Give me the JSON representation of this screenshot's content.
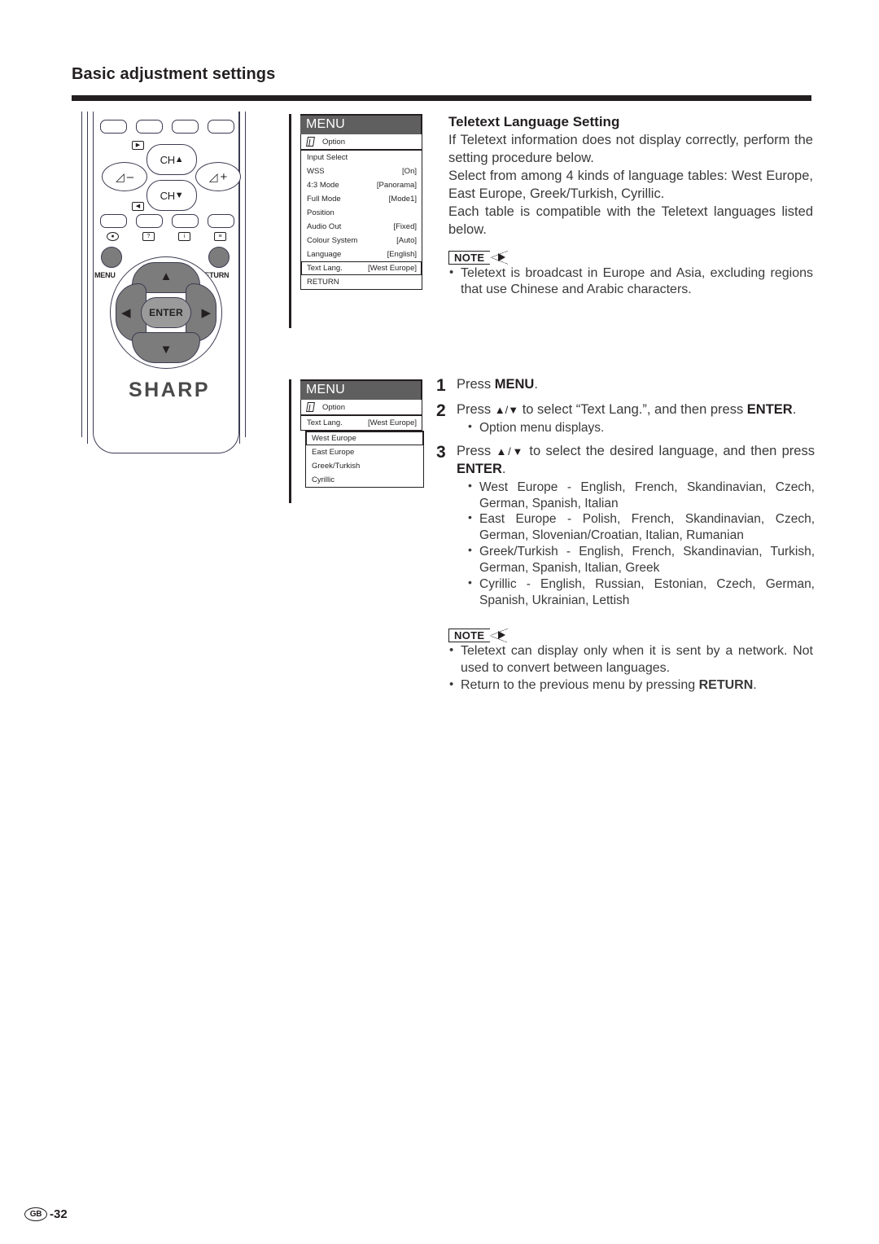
{
  "page": {
    "title": "Basic adjustment settings",
    "footer_region": "GB",
    "footer_page": "-32"
  },
  "remote": {
    "brand": "SHARP",
    "ch_up_label": "CH",
    "ch_down_label": "CH",
    "vol_down_label": "–",
    "vol_up_label": "+",
    "menu_label": "MENU",
    "return_label": "RETURN",
    "enter_label": "ENTER"
  },
  "osd_menu_1": {
    "header": "MENU",
    "option_label": "Option",
    "rows": [
      {
        "label": "Input Select",
        "value": ""
      },
      {
        "label": "WSS",
        "value": "[On]"
      },
      {
        "label": "4:3 Mode",
        "value": "[Panorama]"
      },
      {
        "label": "Full Mode",
        "value": "[Mode1]"
      },
      {
        "label": "Position",
        "value": ""
      },
      {
        "label": "Audio Out",
        "value": "[Fixed]"
      },
      {
        "label": "Colour System",
        "value": "[Auto]"
      },
      {
        "label": "Language",
        "value": "[English]"
      },
      {
        "label": "Text Lang.",
        "value": "[West Europe]"
      },
      {
        "label": "RETURN",
        "value": ""
      }
    ],
    "selected_index": 8
  },
  "osd_menu_2": {
    "header": "MENU",
    "option_label": "Option",
    "parent_row": {
      "label": "Text Lang.",
      "value": "[West Europe]"
    },
    "choices": [
      "West Europe",
      "East Europe",
      "Greek/Turkish",
      "Cyrillic"
    ],
    "selected_index": 0
  },
  "section": {
    "title": "Teletext Language Setting",
    "paragraphs": [
      "If Teletext information does not display correctly, perform the setting procedure below.",
      "Select from among 4 kinds of language tables: West Europe, East Europe, Greek/Turkish, Cyrillic.",
      "Each table is compatible with the Teletext languages listed below."
    ],
    "note_label": "NOTE",
    "note_bullets": [
      "Teletext is broadcast in Europe and Asia, excluding regions that use Chinese and Arabic characters."
    ]
  },
  "steps": [
    {
      "num": "1",
      "text_before": "Press ",
      "bold": "MENU",
      "text_after": ".",
      "sub": []
    },
    {
      "num": "2",
      "text_before": "Press ",
      "arrows": "▲/▼",
      "text_mid": " to select “Text Lang.”, and then press ",
      "bold": "ENTER",
      "text_after": ".",
      "sub": [
        "Option menu displays."
      ]
    },
    {
      "num": "3",
      "text_before": "Press ",
      "arrows": "▲/▼",
      "text_mid": " to select the desired language, and then press ",
      "bold": "ENTER",
      "text_after": ".",
      "sub": [
        "West Europe - English, French, Skandinavian, Czech, German, Spanish, Italian",
        "East Europe - Polish, French, Skandinavian, Czech, German, Slovenian/Croatian, Italian, Rumanian",
        "Greek/Turkish - English, French, Skandinavian, Turkish, German, Spanish, Italian, Greek",
        "Cyrillic - English, Russian, Estonian, Czech, German, Spanish, Ukrainian, Lettish"
      ]
    }
  ],
  "bottom_note": {
    "note_label": "NOTE",
    "bullets": [
      {
        "text": "Teletext can display only when it is sent by a network. Not used to convert between languages.",
        "bold": ""
      },
      {
        "text_before": "Return to the previous menu by pressing ",
        "bold": "RETURN",
        "text_after": "."
      }
    ]
  },
  "colors": {
    "ink": "#231f20",
    "body_text": "#3a3a3a",
    "osd_header_bg": "#5f5f5f",
    "remote_key_gray": "#7c7c7c",
    "remote_outline": "#3b3b52"
  }
}
